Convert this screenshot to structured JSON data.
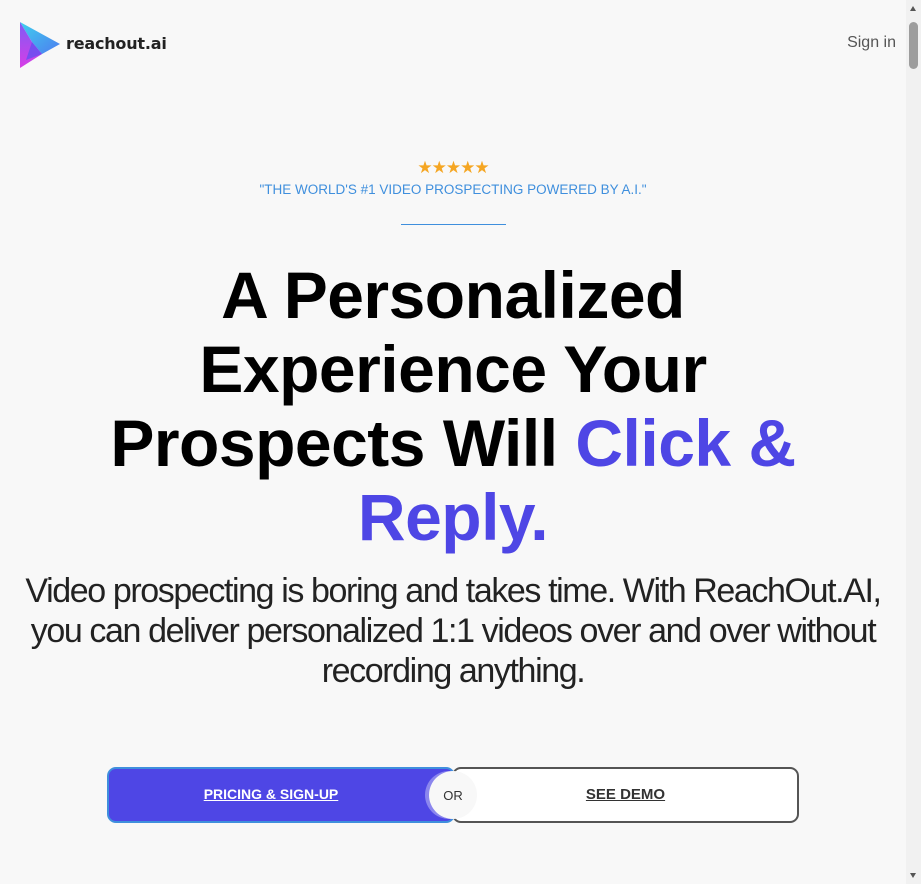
{
  "header": {
    "logo_text": "reachout.ai",
    "signin_label": "Sign in"
  },
  "hero": {
    "stars": "★★★★★",
    "rating": 5,
    "tagline": "\"THE WORLD'S #1 VIDEO PROSPECTING POWERED BY A.I.\"",
    "headline": {
      "line1": "A Personalized",
      "line2": "Experience Your",
      "line3_plain": "Prospects Will ",
      "line3_accent": "Click &",
      "line4_accent": "Reply."
    },
    "subtext": {
      "line1": "Video prospecting is boring and takes time. With ReachOut.AI,",
      "line2": "you can deliver personalized 1:1 videos over and over without",
      "line3": "recording anything."
    }
  },
  "cta": {
    "primary_label": "PRICING & SIGN-UP",
    "or_label": "OR",
    "secondary_label": "SEE DEMO"
  },
  "colors": {
    "accent": "#4e46e5",
    "tagline_blue": "#3f8fdd",
    "star_gold": "#f5a623",
    "background": "#f8f8f8"
  },
  "icons": {
    "logo": "reachout-play-logo-icon"
  }
}
